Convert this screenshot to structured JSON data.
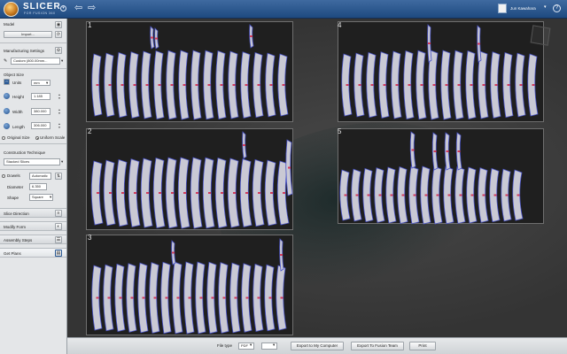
{
  "app": {
    "brand": "SLICER",
    "brand_sub": "FOR FUSION 360",
    "user_name": "Jun Kawahara",
    "help_glyph": "?",
    "caret": "▾",
    "back_glyph": "⇦",
    "forward_glyph": "⇨",
    "accent": "#2b5a95"
  },
  "sidebar": {
    "model_label": "Model",
    "import_label": "Import...",
    "manufacturing_label": "Manufacturing Settings",
    "manufacturing_value": "Custom (800.00mm...",
    "object_size_label": "Object Size",
    "units_label": "Units",
    "units_value": "mm",
    "height_label": "Height",
    "height_value": "1.185",
    "width_label": "Width",
    "width_value": "380.000",
    "length_label": "Length",
    "length_value": "306.000",
    "original_size_label": "Original Size",
    "uniform_scale_label": "Uniform Scale",
    "construction_label": "Construction Technique",
    "construction_value": "Stacked Slices",
    "dowels_label": "Dowels",
    "dowels_value": "Automatic",
    "diameter_label": "Diameter",
    "diameter_value": "6.350",
    "shape_label": "Shape",
    "shape_value": "Square",
    "slice_direction_label": "Slice Direction",
    "modify_form_label": "Modify Form",
    "assembly_steps_label": "Assembly Steps",
    "get_plans_label": "Get Plans"
  },
  "sheets": [
    {
      "number": "1"
    },
    {
      "number": "2"
    },
    {
      "number": "3"
    },
    {
      "number": "4"
    },
    {
      "number": "5"
    }
  ],
  "bottombar": {
    "file_type_label": "File type",
    "file_type_value": "PDF",
    "page_value": "",
    "export_computer_label": "Export to My Computer",
    "export_team_label": "Export To Fusion Team",
    "print_label": "Print"
  }
}
